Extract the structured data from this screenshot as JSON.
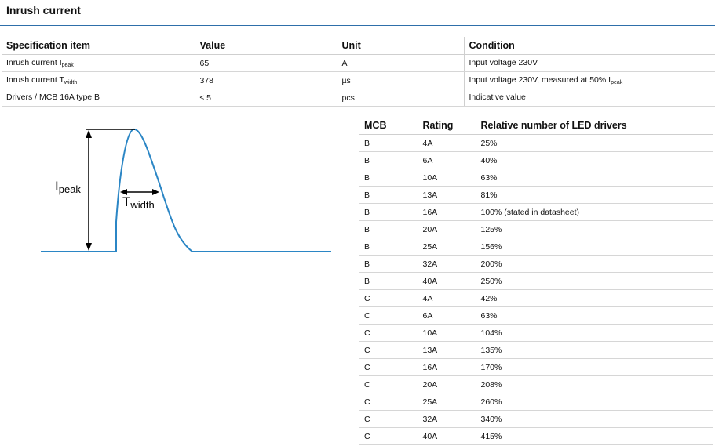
{
  "title": "Inrush current",
  "spec_table": {
    "headers": [
      "Specification item",
      "Value",
      "Unit",
      "Condition"
    ],
    "rows": [
      {
        "item": "Inrush current I",
        "item_sub": "peak",
        "value": "65",
        "unit": "A",
        "condition": "Input voltage 230V",
        "condition_sub": ""
      },
      {
        "item": "Inrush current T",
        "item_sub": "width",
        "value": "378",
        "unit": "µs",
        "condition": "Input voltage 230V, measured at 50% I",
        "condition_sub": "peak"
      },
      {
        "item": "Drivers / MCB 16A type B",
        "item_sub": "",
        "value": "≤ 5",
        "unit": "pcs",
        "condition": "Indicative value",
        "condition_sub": ""
      }
    ]
  },
  "diagram": {
    "ipeak_label": "I",
    "ipeak_sub": "peak",
    "twidth_label": "T",
    "twidth_sub": "width",
    "curve_color": "#2b86c5",
    "line_color": "#000000"
  },
  "mcb_table": {
    "headers": [
      "MCB",
      "Rating",
      "Relative number of LED drivers"
    ],
    "rows": [
      [
        "B",
        "4A",
        "25%"
      ],
      [
        "B",
        "6A",
        "40%"
      ],
      [
        "B",
        "10A",
        "63%"
      ],
      [
        "B",
        "13A",
        "81%"
      ],
      [
        "B",
        "16A",
        "100% (stated in datasheet)"
      ],
      [
        "B",
        "20A",
        "125%"
      ],
      [
        "B",
        "25A",
        "156%"
      ],
      [
        "B",
        "32A",
        "200%"
      ],
      [
        "B",
        "40A",
        "250%"
      ],
      [
        "C",
        "4A",
        "42%"
      ],
      [
        "C",
        "6A",
        "63%"
      ],
      [
        "C",
        "10A",
        "104%"
      ],
      [
        "C",
        "13A",
        "135%"
      ],
      [
        "C",
        "16A",
        "170%"
      ],
      [
        "C",
        "20A",
        "208%"
      ],
      [
        "C",
        "25A",
        "260%"
      ],
      [
        "C",
        "32A",
        "340%"
      ],
      [
        "C",
        "40A",
        "415%"
      ]
    ]
  }
}
